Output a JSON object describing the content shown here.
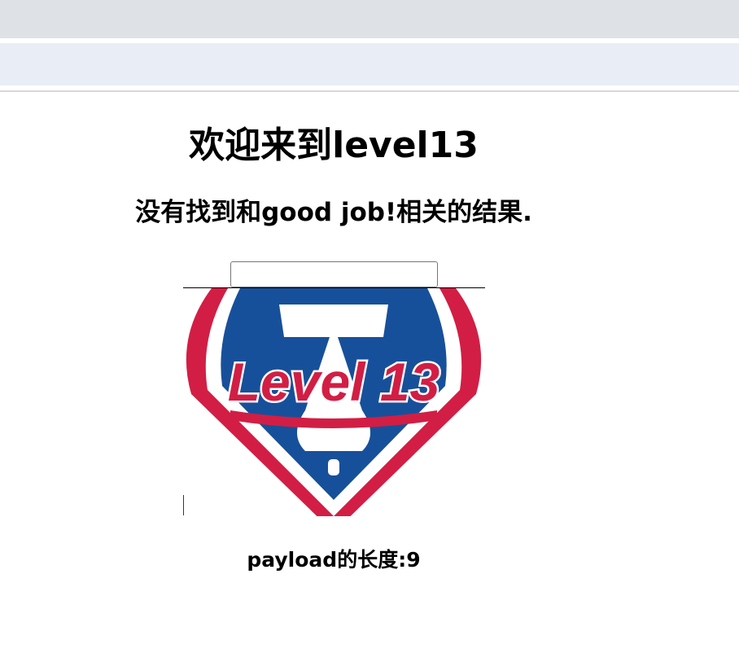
{
  "page": {
    "title": "欢迎来到level13",
    "result_text": "没有找到和good job!相关的结果.",
    "payload_length": "payload的长度:9"
  },
  "search": {
    "value": "",
    "placeholder": ""
  },
  "logo": {
    "text": "Level 13",
    "colors": {
      "red": "#d21e44",
      "blue": "#17509a",
      "white": "#ffffff"
    }
  }
}
